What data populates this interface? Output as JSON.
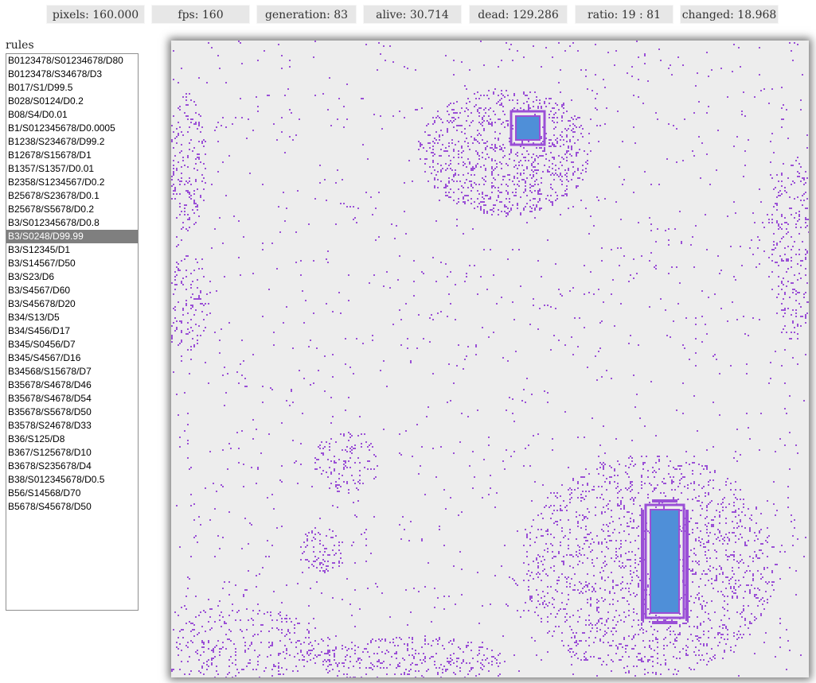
{
  "stats": [
    {
      "label": "pixels: 160.000"
    },
    {
      "label": "fps: 160"
    },
    {
      "label": "generation: 83"
    },
    {
      "label": "alive: 30.714"
    },
    {
      "label": "dead: 129.286"
    },
    {
      "label": "ratio: 19 : 81"
    },
    {
      "label": "changed: 18.968"
    }
  ],
  "rules": {
    "label": "rules",
    "selected_index": 13,
    "items": [
      "B0123478/S01234678/D80",
      "B0123478/S34678/D3",
      "B017/S1/D99.5",
      "B028/S0124/D0.2",
      "B08/S4/D0.01",
      "B1/S012345678/D0.0005",
      "B1238/S234678/D99.2",
      "B12678/S15678/D1",
      "B1357/S1357/D0.01",
      "B2358/S1234567/D0.2",
      "B25678/S23678/D0.1",
      "B25678/S5678/D0.2",
      "B3/S012345678/D0.8",
      "B3/S0248/D99.99",
      "B3/S12345/D1",
      "B3/S14567/D50",
      "B3/S23/D6",
      "B3/S4567/D60",
      "B3/S45678/D20",
      "B34/S13/D5",
      "B34/S456/D17",
      "B345/S0456/D7",
      "B345/S4567/D16",
      "B34568/S15678/D7",
      "B35678/S4678/D46",
      "B35678/S4678/D54",
      "B35678/S5678/D50",
      "B3578/S24678/D33",
      "B36/S125/D8",
      "B367/S125678/D10",
      "B3678/S235678/D4",
      "B38/S012345678/D0.5",
      "B56/S14568/D70",
      "B5678/S45678/D50"
    ]
  },
  "colors": {
    "background": "#ededed",
    "alive": "#9a4fd6",
    "pattern": "#7fa6e0",
    "block": "#4f8fd8",
    "selected_bg": "#7f7f7f",
    "stat_bg": "#e7e7e7"
  }
}
